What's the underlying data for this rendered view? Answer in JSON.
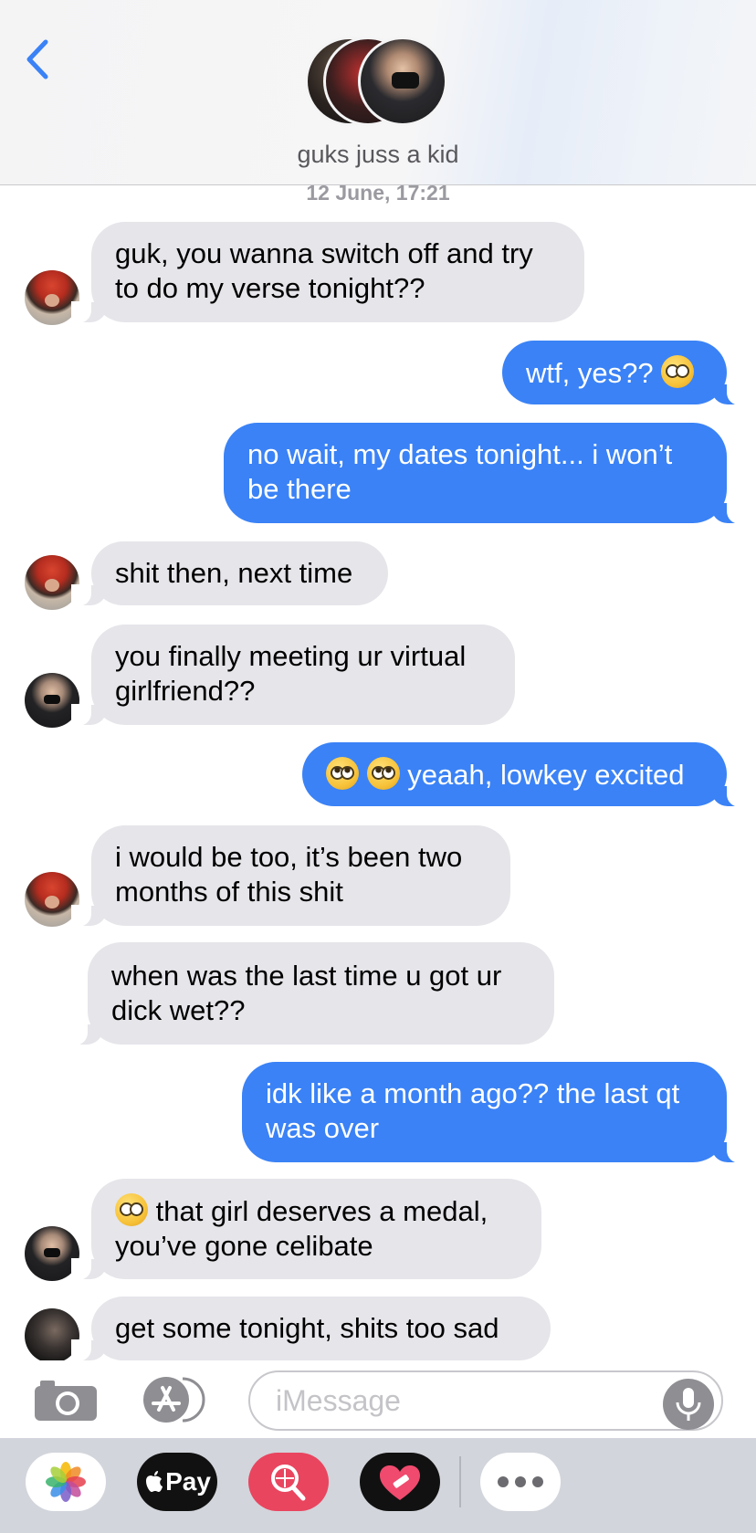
{
  "header": {
    "back_icon": "chevron-left-icon",
    "title": "guks juss a kid",
    "timestamp": "12 June, 17:21",
    "accent_color": "#3a82f6"
  },
  "messages": [
    {
      "side": "received",
      "avatar": "red-hat-avatar",
      "lines": [
        "guk, you wanna switch off and try",
        "to do my verse tonight??"
      ]
    },
    {
      "side": "sent",
      "text": "wtf, yes??",
      "emoji": "flushed-face-emoji"
    },
    {
      "side": "sent",
      "lines": [
        "no wait, my dates tonight... i won’t",
        "be there"
      ]
    },
    {
      "side": "received",
      "avatar": "red-hat-avatar",
      "lines": [
        "shit then, next time"
      ]
    },
    {
      "side": "received",
      "avatar": "masked-avatar",
      "lines": [
        "you finally meeting ur virtual",
        "girlfriend??"
      ]
    },
    {
      "side": "sent",
      "text": "yeaah, lowkey excited",
      "emoji": "eye-roll-emoji"
    },
    {
      "side": "received",
      "avatar": "red-hat-avatar",
      "lines": [
        "i would be too, it’s been two",
        "months of this shit"
      ]
    },
    {
      "side": "received",
      "lines": [
        "when was the last time u got ur",
        "dick wet??"
      ]
    },
    {
      "side": "sent",
      "lines": [
        "idk like a month ago?? the last qt",
        "was over"
      ]
    },
    {
      "side": "received",
      "avatar": "masked-avatar",
      "lines": [
        "that girl deserves a medal,",
        "you’ve gone celibate"
      ],
      "emoji": "flushed-face-emoji"
    },
    {
      "side": "received",
      "avatar": "dark-avatar",
      "lines": [
        "get some tonight, shits too sad"
      ]
    }
  ],
  "input": {
    "placeholder": "iMessage",
    "camera_icon": "camera-icon",
    "apps_icon": "app-store-icon",
    "mic_icon": "microphone-icon"
  },
  "drawer": {
    "apps": [
      "photos-icon",
      "apple-pay-icon",
      "image-search-icon",
      "heart-sticker-icon",
      "more-icon"
    ],
    "pay_label": "Pay"
  },
  "colors": {
    "sent_bubble": "#3a82f6",
    "received_bubble": "#e5e5ea"
  }
}
